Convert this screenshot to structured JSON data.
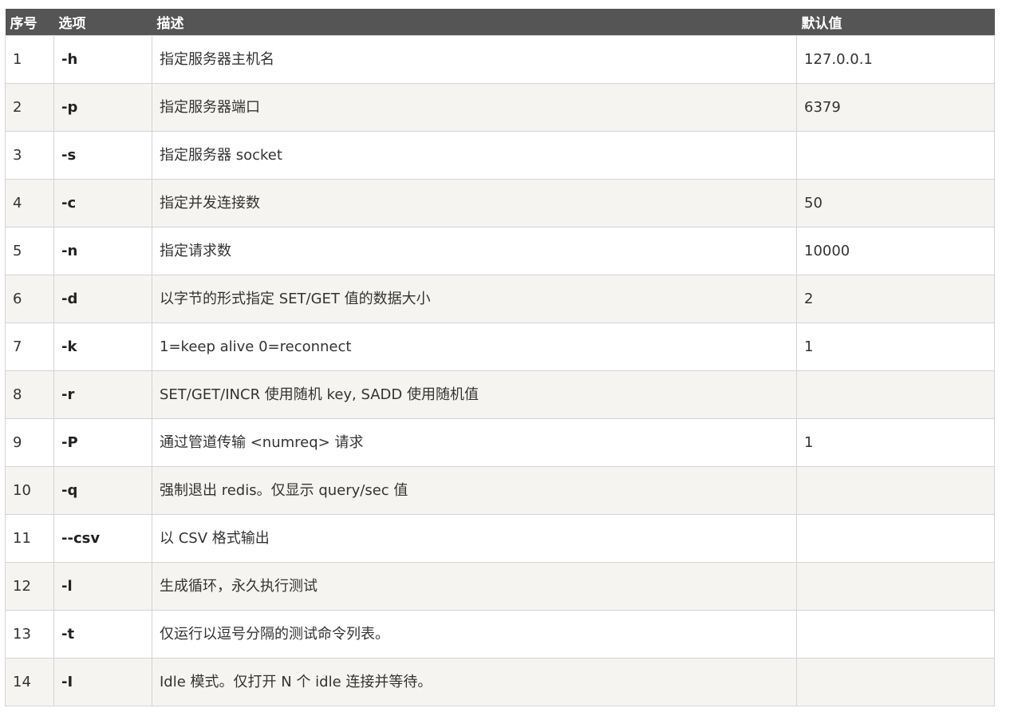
{
  "table": {
    "headers": [
      "序号",
      "选项",
      "描述",
      "默认值"
    ],
    "rows": [
      {
        "seq": "1",
        "option": "-h",
        "desc": "指定服务器主机名",
        "default": "127.0.0.1"
      },
      {
        "seq": "2",
        "option": "-p",
        "desc": "指定服务器端口",
        "default": "6379"
      },
      {
        "seq": "3",
        "option": "-s",
        "desc": "指定服务器 socket",
        "default": ""
      },
      {
        "seq": "4",
        "option": "-c",
        "desc": "指定并发连接数",
        "default": "50"
      },
      {
        "seq": "5",
        "option": "-n",
        "desc": "指定请求数",
        "default": "10000"
      },
      {
        "seq": "6",
        "option": "-d",
        "desc": "以字节的形式指定 SET/GET 值的数据大小",
        "default": "2"
      },
      {
        "seq": "7",
        "option": "-k",
        "desc": "1=keep alive 0=reconnect",
        "default": "1"
      },
      {
        "seq": "8",
        "option": "-r",
        "desc": "SET/GET/INCR 使用随机 key, SADD 使用随机值",
        "default": ""
      },
      {
        "seq": "9",
        "option": "-P",
        "desc": "通过管道传输 <numreq> 请求",
        "default": "1"
      },
      {
        "seq": "10",
        "option": "-q",
        "desc": "强制退出 redis。仅显示 query/sec 值",
        "default": ""
      },
      {
        "seq": "11",
        "option": "--csv",
        "desc": "以 CSV 格式输出",
        "default": ""
      },
      {
        "seq": "12",
        "option": "-l",
        "desc": "生成循环，永久执行测试",
        "default": ""
      },
      {
        "seq": "13",
        "option": "-t",
        "desc": "仅运行以逗号分隔的测试命令列表。",
        "default": ""
      },
      {
        "seq": "14",
        "option": "-I",
        "desc": "Idle 模式。仅打开 N 个 idle 连接并等待。",
        "default": ""
      }
    ]
  }
}
